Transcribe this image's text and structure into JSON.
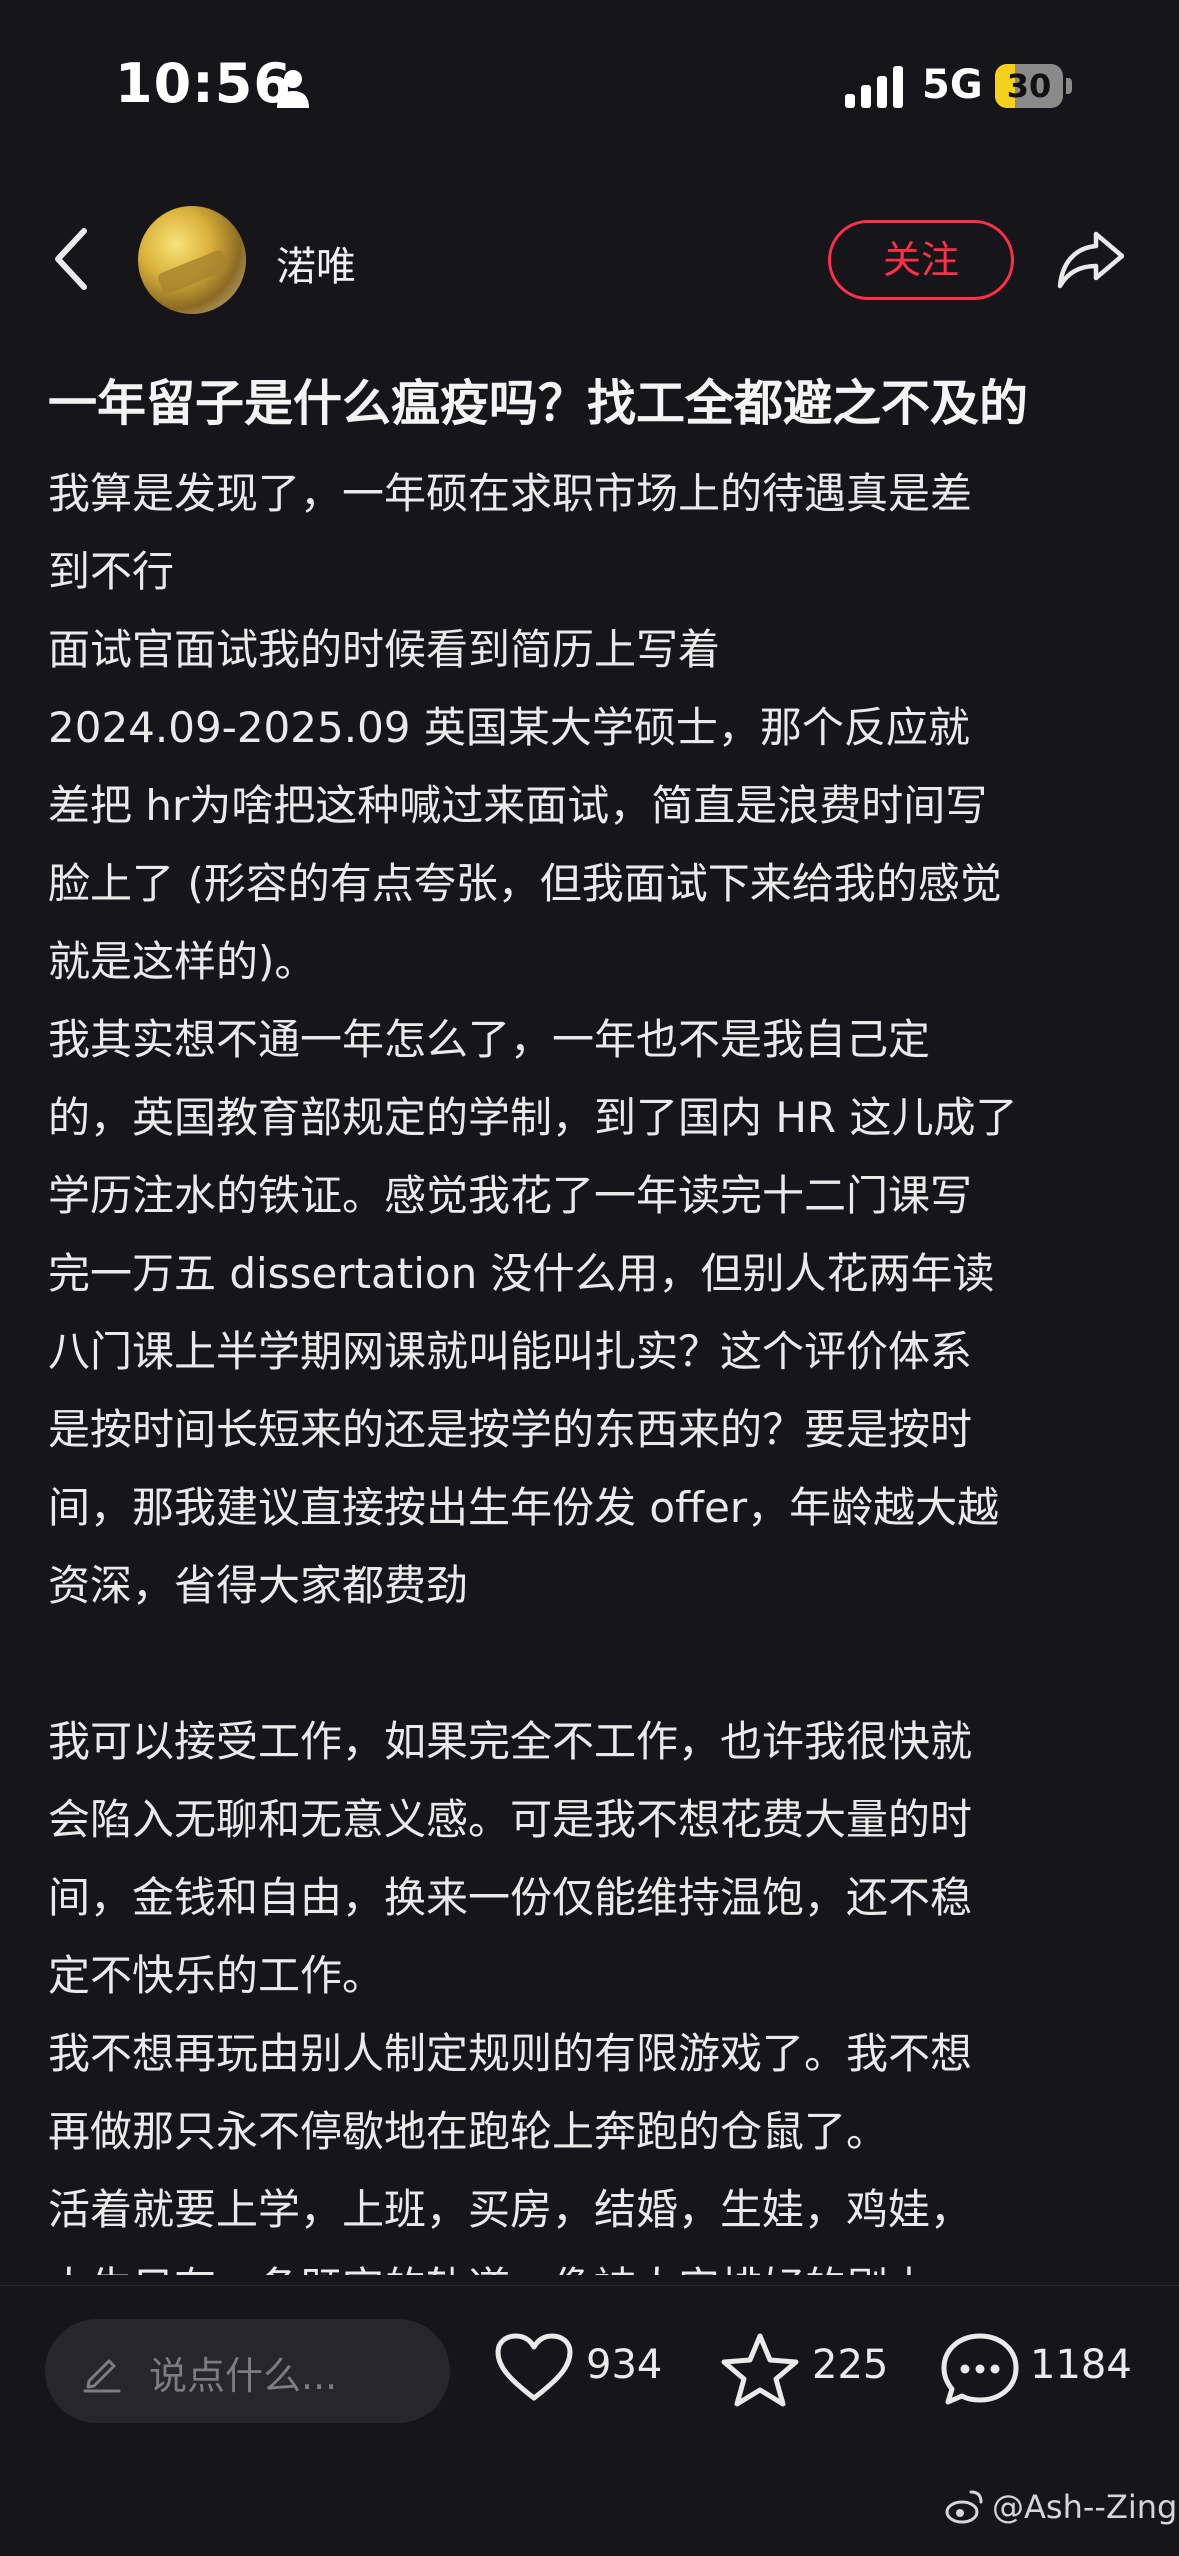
{
  "status_bar": {
    "time": "10:56",
    "network": "5G",
    "battery": "30",
    "battery_level": 0.3
  },
  "header": {
    "username": "渃唯",
    "follow_label": "关注"
  },
  "post": {
    "title": "一年留子是什么瘟疫吗？找工全都避之不及的",
    "lines": [
      "我算是发现了，一年硕在求职市场上的待遇真是差",
      "到不行",
      "面试官面试我的时候看到简历上写着",
      " 2024.09-2025.09 英国某大学硕士，那个反应就",
      "差把 hr为啥把这种喊过来面试，简直是浪费时间写",
      "脸上了 (形容的有点夸张，但我面试下来给我的感觉",
      "就是这样的)。",
      "我其实想不通一年怎么了，一年也不是我自己定",
      "的，英国教育部规定的学制，到了国内 HR 这儿成了",
      "学历注水的铁证。感觉我花了一年读完十二门课写",
      "完一万五 dissertation 没什么用，但别人花两年读",
      "八门课上半学期网课就叫能叫扎实？这个评价体系",
      "是按时间长短来的还是按学的东西来的？要是按时",
      "间，那我建议直接按出生年份发 offer，年龄越大越",
      "资深，省得大家都费劲",
      "",
      "我可以接受工作，如果完全不工作，也许我很快就",
      "会陷入无聊和无意义感。可是我不想花费大量的时",
      "间，金钱和自由，换来一份仅能维持温饱，还不稳",
      "定不快乐的工作。",
      "我不想再玩由别人制定规则的有限游戏了。我不想",
      "再做那只永不停歇地在跑轮上奔跑的仓鼠了。",
      "活着就要上学，上班，买房，结婚，生娃，鸡娃，",
      "人生只有一条既定的轨道，像被人安排好的剧本"
    ]
  },
  "bottom_bar": {
    "comment_placeholder": "说点什么...",
    "likes": "934",
    "favorites": "225",
    "comments": "1184"
  },
  "watermark": "@Ash--Zing",
  "colors": {
    "background": "#16161a",
    "accent": "#ff2f4a",
    "text": "#eaeaea"
  }
}
